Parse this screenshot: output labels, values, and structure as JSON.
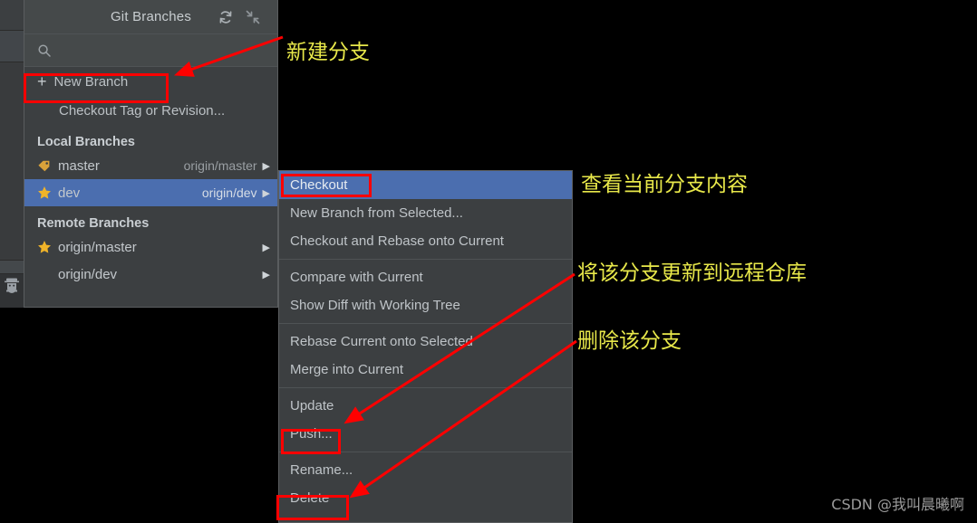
{
  "popup": {
    "title": "Git Branches",
    "refresh_icon": "refresh-icon",
    "collapse_icon": "collapse-icon",
    "search_placeholder": "",
    "search_value": "",
    "search_icon": "search-icon",
    "actions": [
      {
        "label": "New Branch",
        "prefix": "+"
      },
      {
        "label": "Checkout Tag or Revision...",
        "prefix": ""
      }
    ],
    "sections": [
      {
        "header": "Local Branches",
        "branches": [
          {
            "name": "master",
            "tracking": "origin/master",
            "icon": "tag-icon",
            "selected": false,
            "arrow": "▶"
          },
          {
            "name": "dev",
            "tracking": "origin/dev",
            "icon": "star-icon",
            "selected": true,
            "arrow": "▶"
          }
        ]
      },
      {
        "header": "Remote Branches",
        "branches": [
          {
            "name": "origin/master",
            "tracking": "",
            "icon": "star-icon",
            "selected": false,
            "arrow": "▶"
          },
          {
            "name": "origin/dev",
            "tracking": "",
            "icon": "none",
            "selected": false,
            "arrow": "▶"
          }
        ]
      }
    ]
  },
  "context_menu": {
    "groups": [
      [
        {
          "label": "Checkout",
          "active": true
        },
        {
          "label": "New Branch from Selected...",
          "active": false
        },
        {
          "label": "Checkout and Rebase onto Current",
          "active": false
        }
      ],
      [
        {
          "label": "Compare with Current",
          "active": false
        },
        {
          "label": "Show Diff with Working Tree",
          "active": false
        }
      ],
      [
        {
          "label": "Rebase Current onto Selected",
          "active": false
        },
        {
          "label": "Merge into Current",
          "active": false
        }
      ],
      [
        {
          "label": "Update",
          "active": false
        },
        {
          "label": "Push...",
          "active": false
        }
      ],
      [
        {
          "label": "Rename...",
          "active": false
        },
        {
          "label": "Delete",
          "active": false
        }
      ]
    ]
  },
  "annotations": [
    {
      "text": "新建分支",
      "name": "annotation-new-branch"
    },
    {
      "text": "查看当前分支内容",
      "name": "annotation-checkout"
    },
    {
      "text": "将该分支更新到远程仓库",
      "name": "annotation-push"
    },
    {
      "text": "删除该分支",
      "name": "annotation-delete"
    }
  ],
  "watermark": "CSDN @我叫晨曦啊",
  "colors": {
    "annotation": "#e8e84a",
    "highlight": "#ff0000",
    "selection": "#4b6eaf",
    "panel_bg": "#3c3f41",
    "title_bg": "#45494a"
  }
}
